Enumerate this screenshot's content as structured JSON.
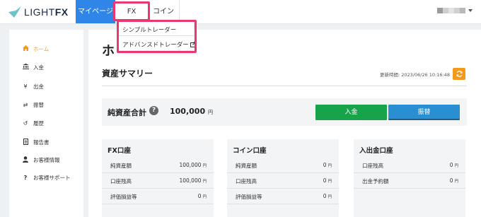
{
  "header": {
    "logo_text": "LIGHT",
    "logo_text_bold": "FX",
    "tabs": [
      {
        "label": "マイページ",
        "active": true
      },
      {
        "label": "FX",
        "active": false
      },
      {
        "label": "コイン",
        "active": false
      }
    ]
  },
  "fx_menu": {
    "items": [
      {
        "label": "シンプルトレーダー"
      },
      {
        "label": "アドバンスドトレーダー",
        "icon": "external-link-icon"
      }
    ]
  },
  "sidebar": {
    "items": [
      {
        "label": "ホーム",
        "icon": "home-icon",
        "active": true
      },
      {
        "label": "入金",
        "icon": "bank-icon"
      },
      {
        "label": "出金",
        "icon": "yen-icon"
      },
      {
        "label": "振替",
        "icon": "transfer-arrows-icon"
      },
      {
        "label": "履歴",
        "icon": "history-icon"
      },
      {
        "label": "報告書",
        "icon": "document-icon"
      },
      {
        "label": "お客様情報",
        "icon": "user-icon"
      },
      {
        "label": "お客様サポート",
        "icon": "question-icon"
      }
    ]
  },
  "main": {
    "page_title": "ホ",
    "section_title": "資産サマリー",
    "updated_label": "更新時間: 2023/06/26 10:16:48",
    "net_assets_label": "純資産合計",
    "net_assets_value": "100,000",
    "unit": "円",
    "deposit_button": "入金",
    "transfer_button": "振替"
  },
  "cards": [
    {
      "title": "FX口座",
      "rows": [
        {
          "label": "純資産額",
          "value": "100,000",
          "unit": "円"
        },
        {
          "label": "口座残高",
          "value": "100,000",
          "unit": "円"
        },
        {
          "label": "評価損益等",
          "value": "0",
          "unit": "円"
        }
      ]
    },
    {
      "title": "コイン口座",
      "rows": [
        {
          "label": "純資産額",
          "value": "0",
          "unit": "円"
        },
        {
          "label": "口座残高",
          "value": "0",
          "unit": "円"
        },
        {
          "label": "評価損益等",
          "value": "0",
          "unit": "円"
        }
      ]
    },
    {
      "title": "入出金口座",
      "rows": [
        {
          "label": "口座残高",
          "value": "0",
          "unit": "円"
        },
        {
          "label": "出金予約額",
          "value": "0",
          "unit": "円"
        }
      ]
    }
  ],
  "colors": {
    "accent_blue": "#2f86e8",
    "highlight": "#e8386f",
    "orange": "#f39a1d",
    "green": "#17a34a",
    "transfer_blue": "#2a8fd1"
  }
}
